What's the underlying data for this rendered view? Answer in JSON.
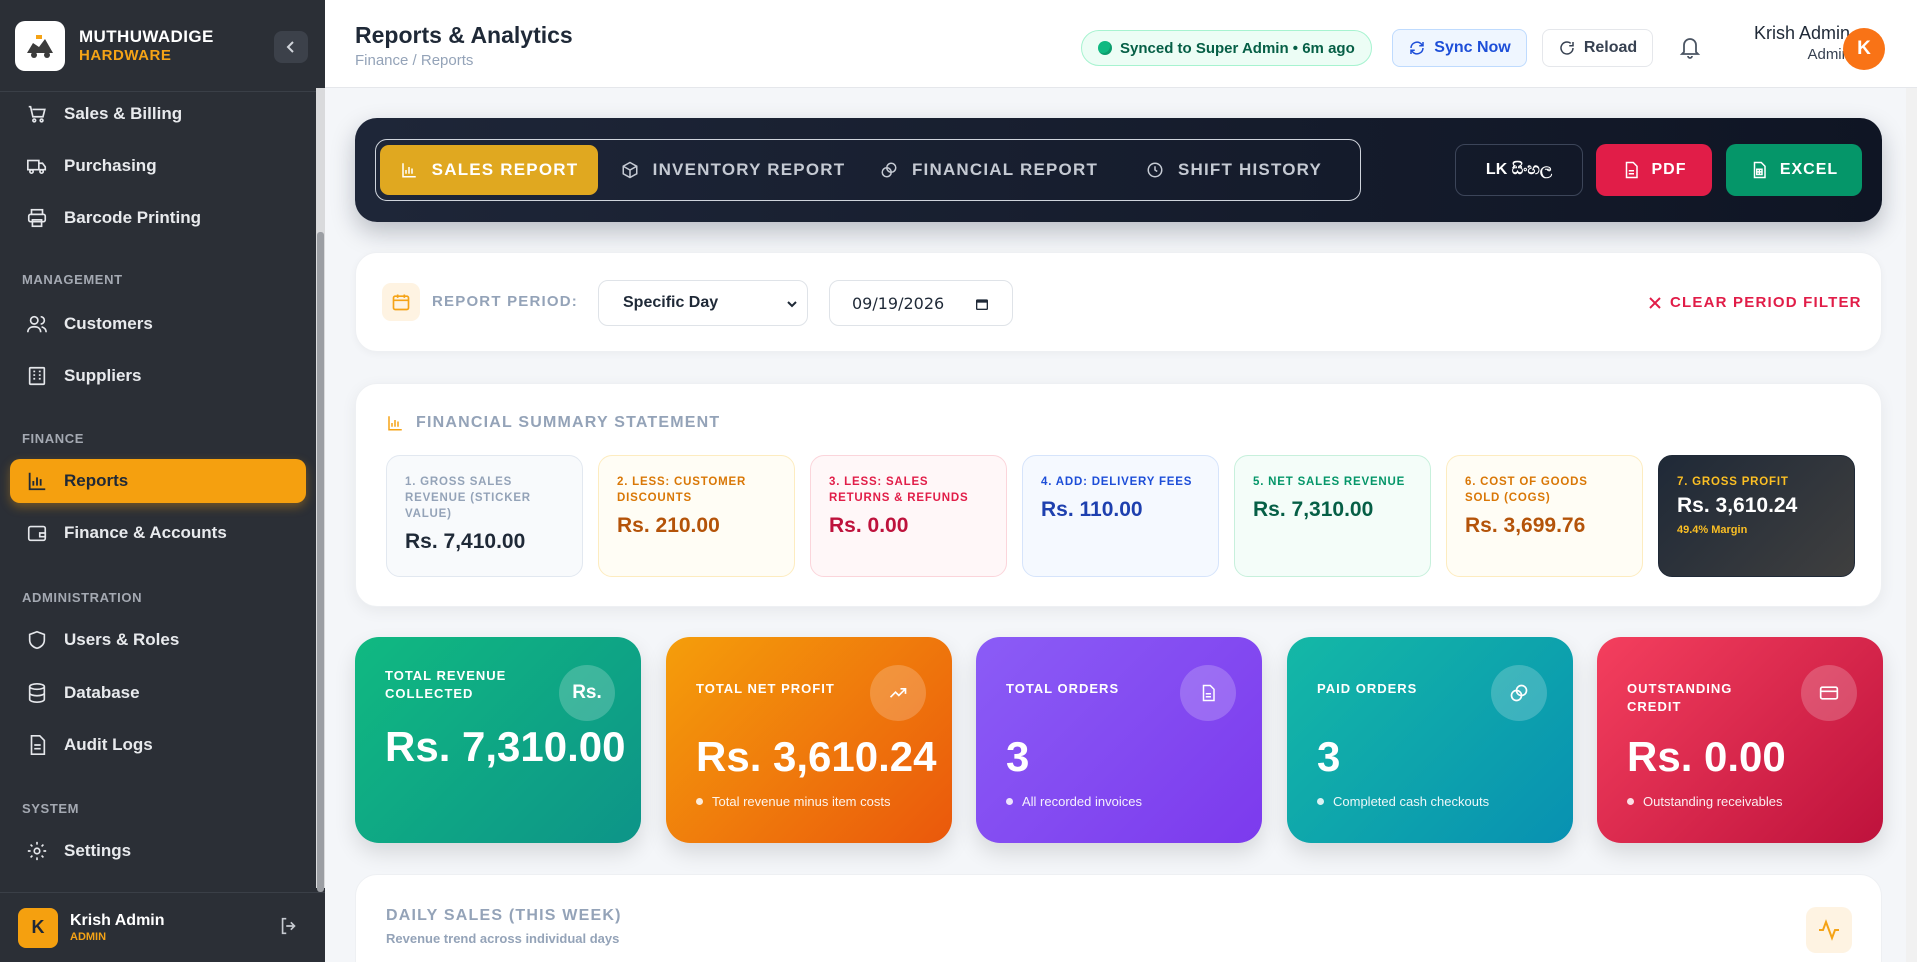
{
  "brand": {
    "name": "MUTHUWADIGE",
    "sub": "HARDWARE"
  },
  "sidebar": {
    "items_top": [
      {
        "label": "Sales & Billing"
      },
      {
        "label": "Purchasing"
      },
      {
        "label": "Barcode Printing"
      }
    ],
    "sections": [
      "MANAGEMENT",
      "FINANCE",
      "ADMINISTRATION",
      "SYSTEM"
    ],
    "management": [
      {
        "label": "Customers"
      },
      {
        "label": "Suppliers"
      }
    ],
    "finance": [
      {
        "label": "Reports"
      },
      {
        "label": "Finance & Accounts"
      }
    ],
    "administration": [
      {
        "label": "Users & Roles"
      },
      {
        "label": "Database"
      },
      {
        "label": "Audit Logs"
      }
    ],
    "system": [
      {
        "label": "Settings"
      }
    ],
    "user": {
      "initial": "K",
      "name": "Krish Admin",
      "role": "ADMIN"
    }
  },
  "header": {
    "title": "Reports & Analytics",
    "breadcrumb": "Finance / Reports",
    "sync_status": "Synced to Super Admin • 6m ago",
    "sync_now": "Sync Now",
    "reload": "Reload",
    "user_name": "Krish Admin",
    "user_role": "Admin",
    "user_initial": "K"
  },
  "toolbar": {
    "tabs": [
      {
        "label": "SALES REPORT"
      },
      {
        "label": "INVENTORY REPORT"
      },
      {
        "label": "FINANCIAL REPORT"
      },
      {
        "label": "SHIFT HISTORY"
      }
    ],
    "active_tab": "SALES REPORT",
    "lang_label": "LK සිංහල",
    "pdf_label": "PDF",
    "excel_label": "EXCEL"
  },
  "period": {
    "label": "REPORT PERIOD:",
    "mode": "Specific Day",
    "date": "09/19/2026",
    "clear_label": "CLEAR PERIOD FILTER"
  },
  "summary": {
    "title": "FINANCIAL SUMMARY STATEMENT",
    "cards": [
      {
        "label": "1. GROSS SALES REVENUE (STICKER VALUE)",
        "value": "Rs. 7,410.00"
      },
      {
        "label": "2. LESS: CUSTOMER DISCOUNTS",
        "value": "Rs. 210.00"
      },
      {
        "label": "3. LESS: SALES RETURNS & REFUNDS",
        "value": "Rs. 0.00"
      },
      {
        "label": "4. ADD: DELIVERY FEES",
        "value": "Rs. 110.00"
      },
      {
        "label": "5. NET SALES REVENUE",
        "value": "Rs. 7,310.00"
      },
      {
        "label": "6. COST OF GOODS SOLD (COGS)",
        "value": "Rs. 3,699.76"
      },
      {
        "label": "7. GROSS PROFIT",
        "value": "Rs. 3,610.24",
        "sub": "49.4% Margin"
      }
    ]
  },
  "kpis": [
    {
      "label": "TOTAL REVENUE COLLECTED",
      "icon_text": "Rs.",
      "value": "Rs. 7,310.00",
      "note": ""
    },
    {
      "label": "TOTAL NET PROFIT",
      "value": "Rs. 3,610.24",
      "note": "Total revenue minus item costs"
    },
    {
      "label": "TOTAL ORDERS",
      "value": "3",
      "note": "All recorded invoices"
    },
    {
      "label": "PAID ORDERS",
      "value": "3",
      "note": "Completed cash checkouts"
    },
    {
      "label": "OUTSTANDING CREDIT",
      "value": "Rs. 0.00",
      "note": "Outstanding receivables"
    }
  ],
  "daily": {
    "title": "DAILY SALES (THIS WEEK)",
    "subtitle": "Revenue trend across individual days"
  },
  "colors": {
    "accent": "#f5a00f",
    "sidebar_bg": "#2b2f36",
    "pdf": "#e11d48",
    "excel": "#059669"
  }
}
